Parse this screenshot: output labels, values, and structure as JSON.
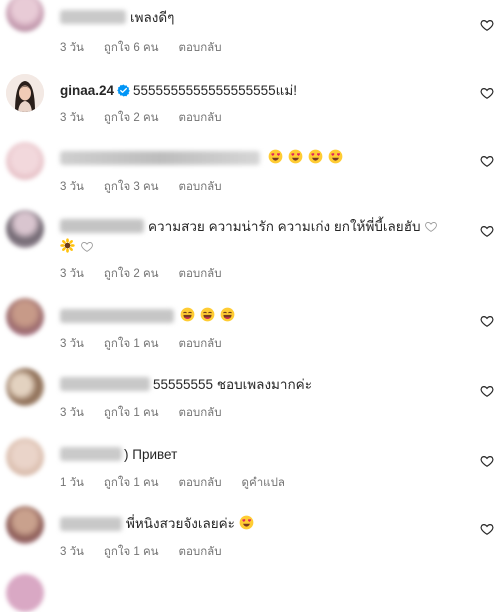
{
  "comments": [
    {
      "text": "เพลงดีๆ",
      "time": "3 วัน",
      "likes": "ถูกใจ 6 คน",
      "reply": "ตอบกลับ"
    },
    {
      "user": "ginaa.24",
      "text": "5555555555555555555แม่!",
      "time": "3 วัน",
      "likes": "ถูกใจ 2 คน",
      "reply": "ตอบกลับ"
    },
    {
      "text": "",
      "time": "3 วัน",
      "likes": "ถูกใจ 3 คน",
      "reply": "ตอบกลับ"
    },
    {
      "text": "ความสวย ความน่ารัก ความเก่ง ยกให้พี่บี้เลยฮับ",
      "time": "3 วัน",
      "likes": "ถูกใจ 2 คน",
      "reply": "ตอบกลับ"
    },
    {
      "text": "",
      "time": "3 วัน",
      "likes": "ถูกใจ 1 คน",
      "reply": "ตอบกลับ"
    },
    {
      "text": "55555555 ชอบเพลงมากค่ะ",
      "time": "3 วัน",
      "likes": "ถูกใจ 1 คน",
      "reply": "ตอบกลับ"
    },
    {
      "text": ") Привет",
      "time": "1 วัน",
      "likes": "ถูกใจ 1 คน",
      "reply": "ตอบกลับ",
      "translate": "ดูคำแปล"
    },
    {
      "text": "พี่หนิงสวยจังเลยค่ะ",
      "time": "3 วัน",
      "likes": "ถูกใจ 1 คน",
      "reply": "ตอบกลับ"
    }
  ],
  "icons": {
    "like": "heart-outline-icon",
    "verified": "verified-badge-icon",
    "emoji_heart_eyes": "heart-eyes-emoji",
    "emoji_laugh": "laughing-emoji",
    "emoji_sunflower": "sunflower-emoji"
  },
  "colors": {
    "verified": "#0095f6",
    "meta": "#737373",
    "emoji": "#ffcc33"
  }
}
